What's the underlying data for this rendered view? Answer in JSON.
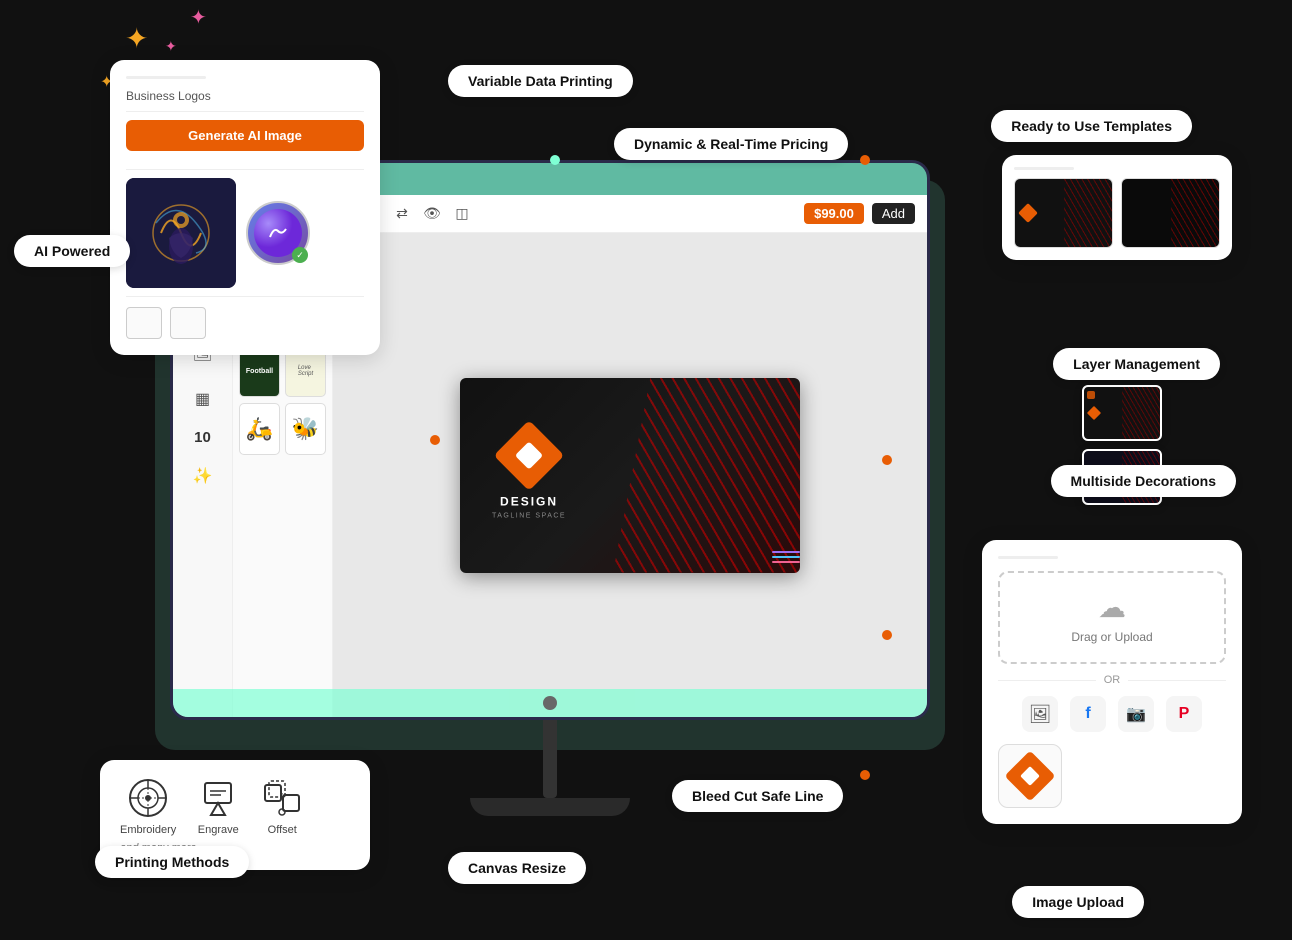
{
  "features": {
    "variable_data_printing": "Variable Data Printing",
    "dynamic_pricing": "Dynamic & Real-Time Pricing",
    "ready_templates": "Ready to Use Templates",
    "layer_management": "Layer Management",
    "multiside_decorations": "Multiside Decorations",
    "bleed_cut": "Bleed Cut Safe Line",
    "image_upload": "Image Upload",
    "printing_methods": "Printing Methods",
    "ai_powered": "AI Powered",
    "canvas_resize": "Canvas Resize"
  },
  "ai_panel": {
    "label": "Business Logos",
    "button_label": "Generate AI Image"
  },
  "canvas": {
    "brand_name": "DESIGN",
    "tagline": "TAGLINE SPACE"
  },
  "pricing": {
    "price": "$99.00",
    "add_label": "Add"
  },
  "upload_panel": {
    "drop_text": "Drag or Upload",
    "or_text": "OR"
  },
  "printing_panel": {
    "items": [
      {
        "label": "Embroidery"
      },
      {
        "label": "Engrave"
      },
      {
        "label": "Offset"
      }
    ],
    "more": "and many more..."
  },
  "toolbar": {
    "inputs": [
      "",
      ""
    ]
  }
}
